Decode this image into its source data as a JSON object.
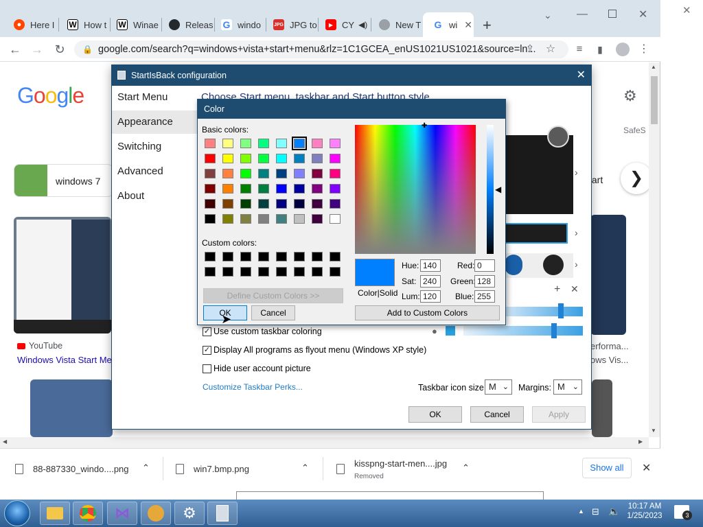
{
  "browser": {
    "tabs": [
      {
        "label": "Here I",
        "icon": "reddit-icon"
      },
      {
        "label": "How t",
        "icon": "wikihow-icon"
      },
      {
        "label": "Winae",
        "icon": "winaero-icon"
      },
      {
        "label": "Releas",
        "icon": "github-icon"
      },
      {
        "label": "windo",
        "icon": "google-icon"
      },
      {
        "label": "JPG to",
        "icon": "jpgpng-icon"
      },
      {
        "label": "CY",
        "icon": "youtube-icon"
      },
      {
        "label": "New T",
        "icon": "newtab-icon"
      },
      {
        "label": "wi",
        "icon": "google-icon"
      }
    ],
    "url": "google.com/search?q=windows+vista+start+menu&rlz=1C1GCEA_enUS1021US1021&source=ln...",
    "new_tab_symbol": "+"
  },
  "google": {
    "logo": "Google",
    "safesearch": "SafeS",
    "chip_left": "windows 7",
    "chip_right": "tart",
    "result_left_source": "YouTube",
    "result_left_title": "Windows Vista Start Men",
    "result_right_title1": "erforma...",
    "result_right_title2": "ows Vis..."
  },
  "startisback": {
    "title": "StartIsBack configuration",
    "nav": [
      "Start Menu",
      "Appearance",
      "Switching",
      "Advanced",
      "About"
    ],
    "heading": "Choose Start menu, taskbar and Start button style",
    "options": {
      "custom_taskbar": "Use custom taskbar coloring",
      "display_all": "Display All programs as flyout menu (Windows XP style)",
      "hide_user": "Hide user account picture"
    },
    "customize_link": "Customize Taskbar Perks...",
    "taskbar_icon_size_label": "Taskbar icon size:",
    "taskbar_icon_size_value": "M",
    "margins_label": "Margins:",
    "margins_value": "M",
    "buttons": {
      "ok": "OK",
      "cancel": "Cancel",
      "apply": "Apply"
    }
  },
  "color_dialog": {
    "title": "Color",
    "basic_colors_label": "Basic colors:",
    "custom_colors_label": "Custom colors:",
    "define_custom": "Define Custom Colors >>",
    "ok": "OK",
    "cancel": "Cancel",
    "add_custom": "Add to Custom Colors",
    "color_solid": "Color|Solid",
    "hue_label": "Hue:",
    "hue": "140",
    "sat_label": "Sat:",
    "sat": "240",
    "lum_label": "Lum:",
    "lum": "120",
    "red_label": "Red:",
    "red": "0",
    "green_label": "Green:",
    "green": "128",
    "blue_label": "Blue:",
    "blue": "255",
    "selected_color": "#0080ff",
    "basic_colors": [
      "#ff8080",
      "#ffff80",
      "#80ff80",
      "#00ff80",
      "#80ffff",
      "#0080ff",
      "#ff80c0",
      "#ff80ff",
      "#ff0000",
      "#ffff00",
      "#80ff00",
      "#00ff40",
      "#00ffff",
      "#0080c0",
      "#8080c0",
      "#ff00ff",
      "#804040",
      "#ff8040",
      "#00ff00",
      "#008080",
      "#004080",
      "#8080ff",
      "#800040",
      "#ff0080",
      "#800000",
      "#ff8000",
      "#008000",
      "#008040",
      "#0000ff",
      "#0000a0",
      "#800080",
      "#8000ff",
      "#400000",
      "#804000",
      "#004000",
      "#004040",
      "#000080",
      "#000040",
      "#400040",
      "#400080",
      "#000000",
      "#808000",
      "#808040",
      "#808080",
      "#408080",
      "#c0c0c0",
      "#400040",
      "#ffffff"
    ]
  },
  "downloads": {
    "items": [
      {
        "name": "88-887330_windo....png",
        "status": ""
      },
      {
        "name": "win7.bmp.png",
        "status": ""
      },
      {
        "name": "kisspng-start-men....jpg",
        "status": "Removed"
      }
    ],
    "show_all": "Show all"
  },
  "taskbar": {
    "time": "10:17 AM",
    "date": "1/25/2023",
    "notification_count": "3"
  }
}
